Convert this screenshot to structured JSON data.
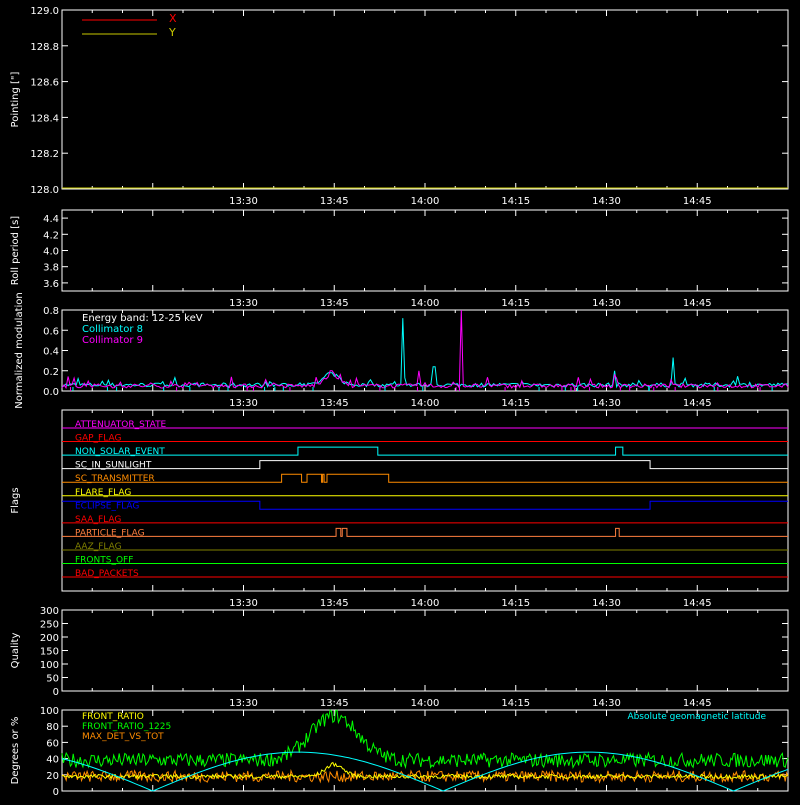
{
  "colors": {
    "axes": "#ffffff",
    "x": "#ff0000",
    "y": "#c8c800",
    "cyan": "#00ffff",
    "magenta": "#ff00ff",
    "green": "#00ff00",
    "orange": "#ff8c00",
    "yellow": "#ffff00",
    "blue": "#0000ff",
    "red": "#ff0000",
    "olive": "#808000",
    "grey_orange": "#ff7f3f"
  },
  "time_ticks": [
    "13:30",
    "13:45",
    "14:00",
    "14:15",
    "14:30",
    "14:45"
  ],
  "chart_data": [
    {
      "type": "line",
      "id": "pointing",
      "ylabel": "Pointing [\"]",
      "ylim": [
        128.0,
        129.0
      ],
      "yticks": [
        "128.0",
        "128.2",
        "128.4",
        "128.6",
        "128.8",
        "129.0"
      ],
      "legend": [
        {
          "name": "X",
          "color": "#ff0000"
        },
        {
          "name": "Y",
          "color": "#c8c800"
        }
      ],
      "legend_placement": "top-left",
      "series": [
        {
          "name": "Y",
          "values": [
            128.0,
            128.0
          ]
        }
      ]
    },
    {
      "type": "line",
      "id": "roll",
      "ylabel": "Roll period [s]",
      "ylim": [
        3.5,
        4.5
      ],
      "yticks": [
        "3.6",
        "3.8",
        "4.0",
        "4.2",
        "4.4"
      ],
      "series": []
    },
    {
      "type": "line",
      "id": "modulation",
      "ylabel": "Normalized modulation",
      "ylim": [
        0.0,
        0.8
      ],
      "yticks": [
        "0.0",
        "0.2",
        "0.4",
        "0.6",
        "0.8"
      ],
      "legend": [
        {
          "name": "Energy band: 12-25 keV",
          "color": "#ffffff"
        },
        {
          "name": "Collimator 8",
          "color": "#00ffff"
        },
        {
          "name": "Collimator 9",
          "color": "#ff00ff"
        }
      ],
      "legend_placement": "top-left",
      "series": [
        {
          "name": "Collimator 8",
          "baseline": 0.06,
          "peaks": [
            [
              13.742,
              0.18
            ],
            [
              13.94,
              0.72
            ],
            [
              14.025,
              0.24
            ],
            [
              14.52,
              0.2
            ],
            [
              14.685,
              0.33
            ]
          ]
        },
        {
          "name": "Collimator 9",
          "baseline": 0.05,
          "peaks": [
            [
              13.742,
              0.2
            ],
            [
              13.985,
              0.2
            ],
            [
              14.1,
              0.8
            ],
            [
              14.52,
              0.16
            ]
          ]
        }
      ]
    },
    {
      "type": "line",
      "id": "flags",
      "ylabel": "Flags",
      "flags": [
        {
          "name": "ATTENUATOR_STATE",
          "color": "#ff00ff",
          "steps": []
        },
        {
          "name": "GAP_FLAG",
          "color": "#ff0000",
          "steps": []
        },
        {
          "name": "NON_SOLAR_EVENT",
          "color": "#00ffff",
          "steps": [
            [
              13.65,
              13.87
            ],
            [
              14.525,
              14.545
            ]
          ]
        },
        {
          "name": "SC_IN_SUNLIGHT",
          "color": "#ffffff",
          "steps": [
            [
              13.545,
              14.62
            ]
          ]
        },
        {
          "name": "SC_TRANSMITTER",
          "color": "#ff8c00",
          "steps": [
            [
              13.605,
              13.66
            ],
            [
              13.675,
              13.715
            ],
            [
              13.718,
              13.722
            ],
            [
              13.73,
              13.9
            ]
          ]
        },
        {
          "name": "FLARE_FLAG",
          "color": "#ffff00",
          "steps": []
        },
        {
          "name": "ECLIPSE_FLAG",
          "color": "#0000ff",
          "steps": [
            [
              13.0,
              13.545
            ],
            [
              14.62,
              15.0
            ]
          ]
        },
        {
          "name": "SAA_FLAG",
          "color": "#ff0000",
          "steps": []
        },
        {
          "name": "PARTICLE_FLAG",
          "color": "#ff7f3f",
          "steps": [
            [
              13.755,
              13.768
            ],
            [
              13.772,
              13.785
            ],
            [
              14.525,
              14.535
            ]
          ]
        },
        {
          "name": "AAZ_FLAG",
          "color": "#808000",
          "steps": []
        },
        {
          "name": "FRONTS_OFF",
          "color": "#00ff00",
          "steps": []
        },
        {
          "name": "BAD_PACKETS",
          "color": "#ff0000",
          "steps": []
        }
      ]
    },
    {
      "type": "line",
      "id": "quality",
      "ylabel": "Quality",
      "ylim": [
        0,
        300
      ],
      "yticks": [
        "0",
        "50",
        "100",
        "150",
        "200",
        "250",
        "300"
      ],
      "series": []
    },
    {
      "type": "line",
      "id": "ratio",
      "ylabel": "Degrees or %",
      "ylim": [
        0,
        100
      ],
      "yticks": [
        "0",
        "20",
        "40",
        "60",
        "80",
        "100"
      ],
      "legend": [
        {
          "name": "FRONT_RATIO",
          "color": "#ffff00"
        },
        {
          "name": "FRONT_RATIO_1225",
          "color": "#00ff00"
        },
        {
          "name": "MAX_DET_VS_TOT",
          "color": "#ff8c00"
        }
      ],
      "right_label": {
        "name": "Absolute geomagnetic latitude",
        "color": "#00ffff"
      },
      "series": [
        {
          "name": "FRONT_RATIO_1225",
          "base": 38,
          "bump_center": 13.75,
          "bump_height": 55
        },
        {
          "name": "MAX_DET_VS_TOT",
          "base": 18
        },
        {
          "name": "FRONT_RATIO",
          "base": 18,
          "bump_center": 13.75,
          "bump_height": 15
        },
        {
          "name": "Absolute geomagnetic latitude",
          "min": 0,
          "max": 48
        }
      ]
    }
  ]
}
